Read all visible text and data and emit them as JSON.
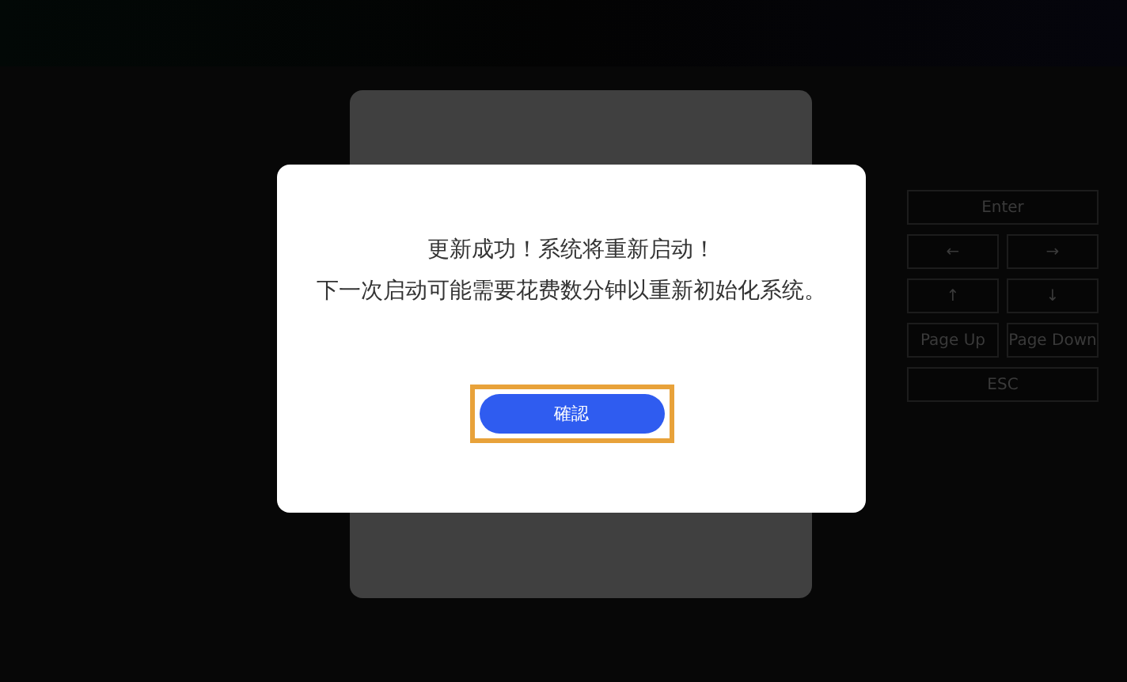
{
  "dialog": {
    "lines": [
      "更新成功！系统将重新启动！",
      "下一次启动可能需要花费数分钟以重新初始化系统。"
    ],
    "confirm_button": {
      "label": "確認",
      "highlighted": true
    }
  },
  "shortcut_panel": {
    "keys": [
      {
        "label": "Enter",
        "wide": true
      },
      {
        "label": "←",
        "wide": false
      },
      {
        "label": "→",
        "wide": false
      },
      {
        "label": "↑",
        "wide": false
      },
      {
        "label": "↓",
        "wide": false
      },
      {
        "label": "Page Up",
        "wide": false
      },
      {
        "label": "Page Down",
        "wide": false
      },
      {
        "label": "ESC",
        "wide": true
      }
    ]
  }
}
